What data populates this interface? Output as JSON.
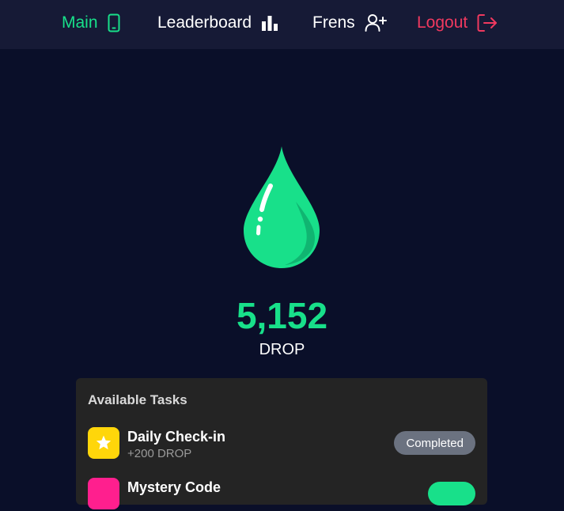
{
  "nav": {
    "main_label": "Main",
    "leaderboard_label": "Leaderboard",
    "frens_label": "Frens",
    "logout_label": "Logout"
  },
  "balance": {
    "amount": "5,152",
    "unit": "DROP"
  },
  "tasks": {
    "title": "Available Tasks",
    "items": [
      {
        "name": "Daily Check-in",
        "reward": "+200 DROP",
        "status": "Completed",
        "icon": "star-icon"
      },
      {
        "name": "Mystery Code",
        "reward": "",
        "status": "",
        "icon": ""
      }
    ]
  },
  "colors": {
    "background": "#0a0f29",
    "navbar": "#161a36",
    "accent": "#18e08a",
    "logout": "#f0395f",
    "card": "#242424",
    "badge_completed": "#6b7280",
    "star_tile": "#ffd60a",
    "mystery_tile": "#ff1f8e"
  }
}
